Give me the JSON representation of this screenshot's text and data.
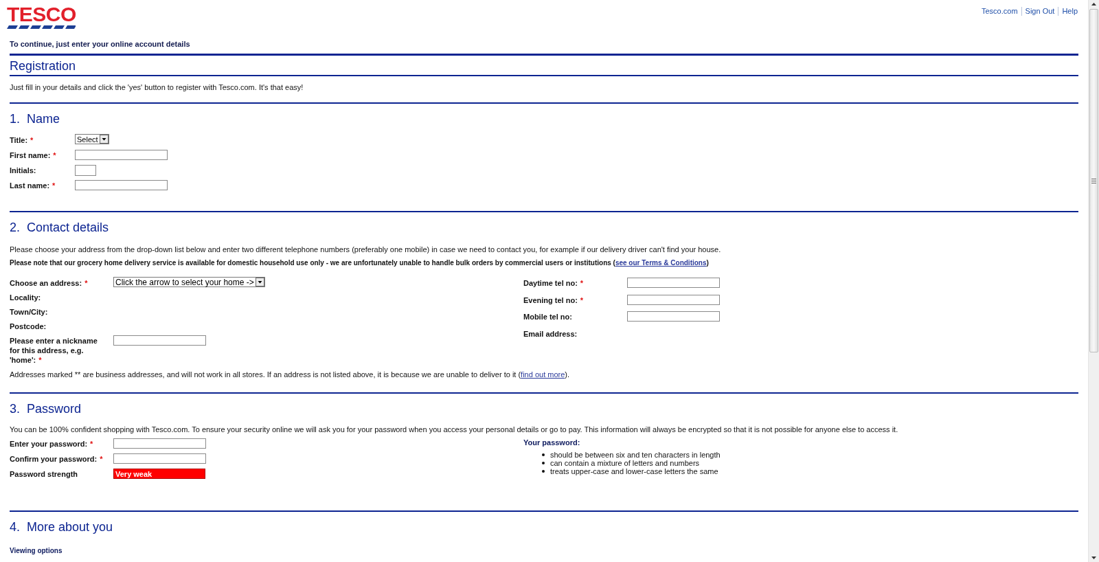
{
  "header": {
    "logo": "TESCO",
    "links": [
      "Tesco.com",
      "Sign Out",
      "Help"
    ]
  },
  "intro": "To continue, just enter your online account details",
  "registration": {
    "title": "Registration",
    "text": "Just fill in your details and click the 'yes' button to register with Tesco.com. It's that easy!"
  },
  "sections": [
    {
      "number": "1.",
      "title": "Name",
      "kind": "name",
      "columns": [
        {
          "kind": "fields",
          "fields": [
            {
              "label": "Title:",
              "required_mark": "*",
              "kind": "select",
              "value": "Select"
            },
            {
              "label": "First name:",
              "required_mark": "*",
              "kind": "text"
            },
            {
              "label": "Initials:",
              "kind": "initials"
            },
            {
              "label": "Last name:",
              "required_mark": "*",
              "kind": "text"
            }
          ]
        }
      ]
    },
    {
      "number": "2.",
      "title": "Contact details",
      "kind": "contact",
      "paragraphs": [
        {
          "kind": "plain",
          "text": "Please choose your address from the drop-down list below and enter two different telephone numbers (preferably one mobile) in case we need to contact you, for example if our delivery driver can't find your house."
        },
        {
          "kind": "bold",
          "text": "Please note that our grocery home delivery service is available for domestic household use only - we are unfortunately unable to handle bulk orders by commercial users or institutions (",
          "link": "see our Terms & Conditions",
          "after": ")"
        }
      ],
      "columns": [
        {
          "kind": "fields",
          "fields": [
            {
              "label": "Choose an address:",
              "required_mark": "*",
              "kind": "select",
              "value": "Click the arrow to select your home ->"
            },
            {
              "label": "Locality:",
              "kind": "info"
            },
            {
              "label": "Town/City:",
              "kind": "info"
            },
            {
              "label": "Postcode:",
              "kind": "info"
            },
            {
              "label": "Please enter a nickname for this address, e.g. 'home':",
              "required_mark": "*",
              "kind": "text"
            }
          ]
        },
        {
          "kind": "fields",
          "fields": [
            {
              "label": "Daytime tel no:",
              "required_mark": "*",
              "kind": "text"
            },
            {
              "label": "Evening tel no:",
              "required_mark": "*",
              "kind": "text"
            },
            {
              "label": "Mobile tel no:",
              "kind": "text"
            },
            {
              "label": "Email address:",
              "kind": "info"
            }
          ]
        }
      ],
      "notes": [
        {
          "kind": "plain",
          "text": "Addresses marked ** are business addresses, and will not work in all stores. If an address is not listed above, it is because we are unable to deliver to it (",
          "link": "find out more",
          "after": ")."
        }
      ]
    },
    {
      "number": "3.",
      "title": "Password",
      "kind": "password",
      "paragraphs": [
        {
          "kind": "plain",
          "text": "You can be 100% confident shopping with Tesco.com. To ensure your security online we will ask you for your password when you access your personal details or go to pay. This information will always be encrypted so that it is not possible for anyone else to access it."
        }
      ],
      "columns": [
        {
          "kind": "fields",
          "fields": [
            {
              "label": "Enter your password:",
              "required_mark": "*",
              "kind": "text"
            },
            {
              "label": "Confirm your password:",
              "required_mark": "*",
              "kind": "text"
            },
            {
              "label": "Password strength",
              "kind": "meter",
              "value": "Very weak"
            }
          ]
        },
        {
          "kind": "hints",
          "title": "Your password:",
          "items": [
            "should be between six and ten characters in length",
            "can contain a mixture of letters and numbers",
            "treats upper-case and lower-case letters the same"
          ]
        }
      ]
    },
    {
      "number": "4.",
      "title": "More about you",
      "kind": "more",
      "subheading": "Viewing options"
    }
  ]
}
